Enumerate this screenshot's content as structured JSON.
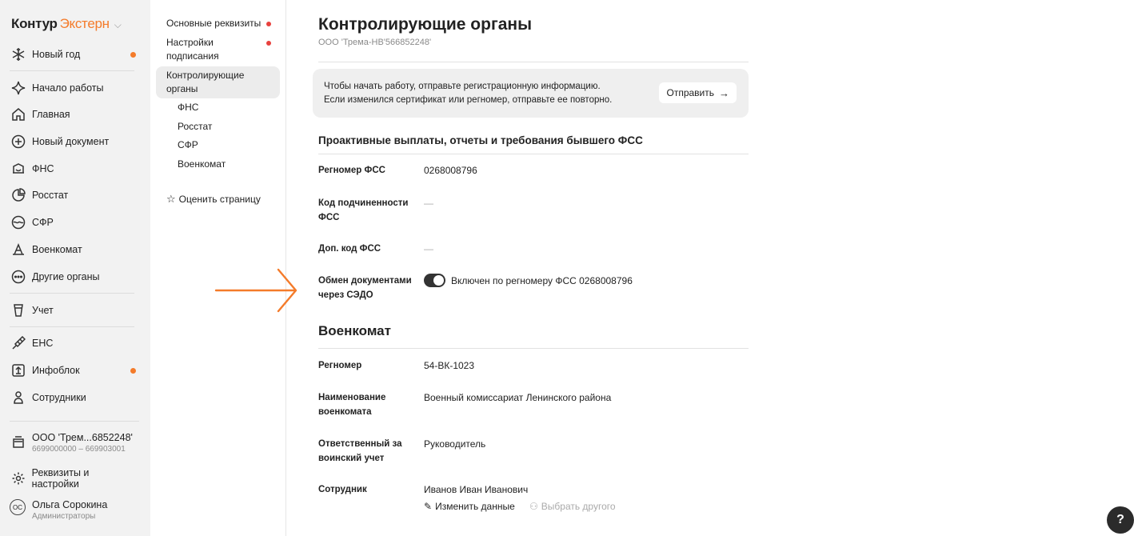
{
  "app": {
    "brand_main": "Контур",
    "brand_product": "Экстерн"
  },
  "sidebar": {
    "items": [
      {
        "label": "Новый год",
        "icon": "snowflake-icon",
        "dot": true
      },
      {
        "label": "Начало работы",
        "icon": "sparkle-icon"
      },
      {
        "label": "Главная",
        "icon": "home-icon"
      },
      {
        "label": "Новый документ",
        "icon": "plus-circle-icon"
      },
      {
        "label": "ФНС",
        "icon": "fns-icon"
      },
      {
        "label": "Росстат",
        "icon": "rosstat-icon"
      },
      {
        "label": "СФР",
        "icon": "sfr-icon"
      },
      {
        "label": "Военкомат",
        "icon": "voenkomat-icon"
      },
      {
        "label": "Другие органы",
        "icon": "more-circle-icon"
      },
      {
        "label": "Учет",
        "icon": "accounting-icon"
      },
      {
        "label": "ЕНС",
        "icon": "ens-icon"
      },
      {
        "label": "Инфоблок",
        "icon": "infoblock-icon",
        "dot": true
      },
      {
        "label": "Сотрудники",
        "icon": "employees-icon"
      }
    ],
    "org": {
      "name": "ООО 'Трем...6852248'",
      "sub": "6699000000 – 669903001"
    },
    "settings_label": "Реквизиты и настройки",
    "user": {
      "initials": "ОС",
      "name": "Ольга Сорокина",
      "role": "Администраторы"
    }
  },
  "subnav": {
    "items": [
      {
        "label": "Основные реквизиты"
      },
      {
        "label": "Настройки подписания"
      },
      {
        "label": "Контролирующие органы"
      }
    ],
    "children": [
      "ФНС",
      "Росстат",
      "СФР",
      "Военкомат"
    ],
    "rate_label": "Оценить страницу"
  },
  "main": {
    "title": "Контролирующие органы",
    "subtitle": "ООО 'Трема-НВ'566852248'",
    "notice": {
      "line1": "Чтобы начать работу, отправьте регистрационную информацию.",
      "line2": "Если изменился сертификат или регномер, отправьте ее повторно.",
      "button": "Отправить"
    },
    "fss": {
      "heading": "Проактивные выплаты, отчеты и требования бывшего ФСС",
      "regnum_label": "Регномер ФСС",
      "regnum_value": "0268008796",
      "subcode_label": "Код подчиненности ФСС",
      "subcode_value": "—",
      "addcode_label": "Доп. код ФСС",
      "addcode_value": "—",
      "sedo_label": "Обмен документами через СЭДО",
      "sedo_value": "Включен по регномеру ФСС 0268008796",
      "sedo_enabled": true
    },
    "voenkomat": {
      "heading": "Военкомат",
      "regnum_label": "Регномер",
      "regnum_value": "54-ВК-1023",
      "name_label": "Наименование военкомата",
      "name_value": "Военный комиссариат Ленинского района",
      "resp_label": "Ответственный за воинский учет",
      "resp_value": "Руководитель",
      "employee_label": "Сотрудник",
      "employee_value": "Иванов Иван Иванович",
      "edit_link": "Изменить данные",
      "choose_link": "Выбрать другого"
    }
  },
  "colors": {
    "accent": "#f47b2a",
    "dot_red": "#e8413d"
  }
}
